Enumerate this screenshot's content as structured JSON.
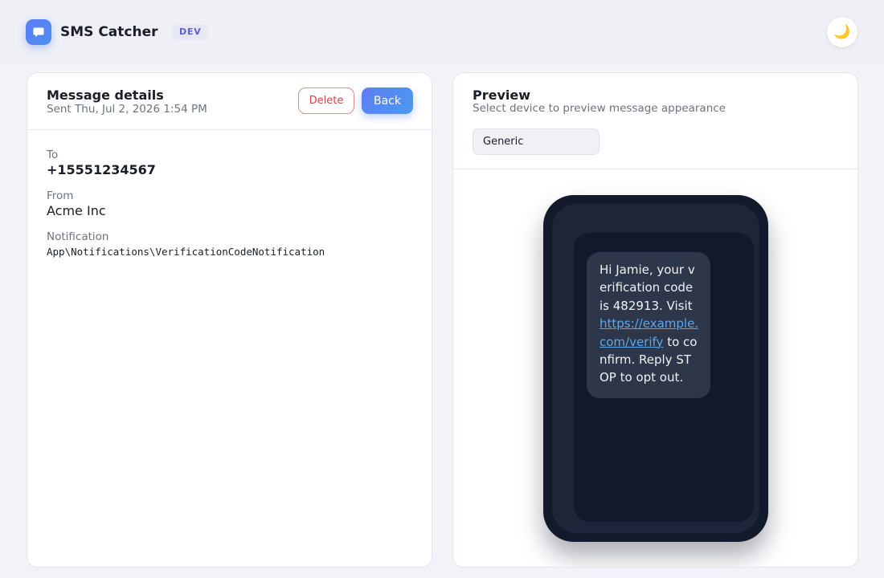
{
  "app": {
    "title": "SMS Catcher",
    "env_badge": "DEV",
    "theme_toggle_icon": "moon-icon"
  },
  "details": {
    "title": "Message details",
    "sent": "Sent Thu, Jul 2, 2026 1:54 PM",
    "delete_label": "Delete",
    "back_label": "Back",
    "to_label": "To",
    "to_value": "+15551234567",
    "from_label": "From",
    "from_value": "Acme Inc",
    "notification_label": "Notification",
    "notification_value": "App\\Notifications\\VerificationCodeNotification"
  },
  "preview": {
    "title": "Preview",
    "subtitle": "Select device to preview message appearance",
    "device_selected": "Generic",
    "message_before": "Hi Jamie, your verification code is 482913. Visit ",
    "message_link": "https://example.com/verify",
    "message_after": " to confirm. Reply STOP to opt out."
  },
  "colors": {
    "accent": "#5f7cf4",
    "danger": "#d64545",
    "link": "#5aa8f0",
    "phone_body": "#121a2b",
    "bubble": "#2d3749"
  }
}
